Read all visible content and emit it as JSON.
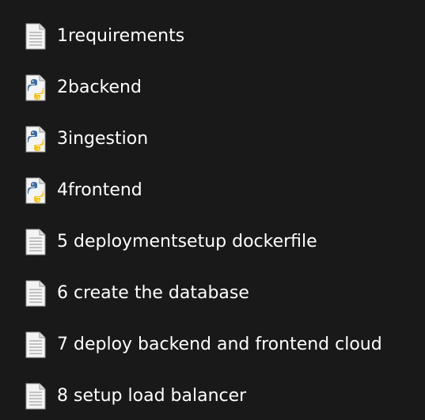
{
  "files": [
    {
      "name": "1requirements",
      "icon": "text-file-icon"
    },
    {
      "name": "2backend",
      "icon": "python-file-icon"
    },
    {
      "name": "3ingestion",
      "icon": "python-file-icon"
    },
    {
      "name": "4frontend",
      "icon": "python-file-icon"
    },
    {
      "name": "5 deploymentsetup dockerfile",
      "icon": "text-file-icon"
    },
    {
      "name": "6 create the database",
      "icon": "text-file-icon"
    },
    {
      "name": "7 deploy backend and frontend cloud",
      "icon": "text-file-icon"
    },
    {
      "name": "8 setup load balancer",
      "icon": "text-file-icon"
    }
  ],
  "colors": {
    "background": "#191919",
    "text": "#ffffff",
    "python_blue": "#3a6ea5",
    "python_yellow": "#f5c518"
  }
}
